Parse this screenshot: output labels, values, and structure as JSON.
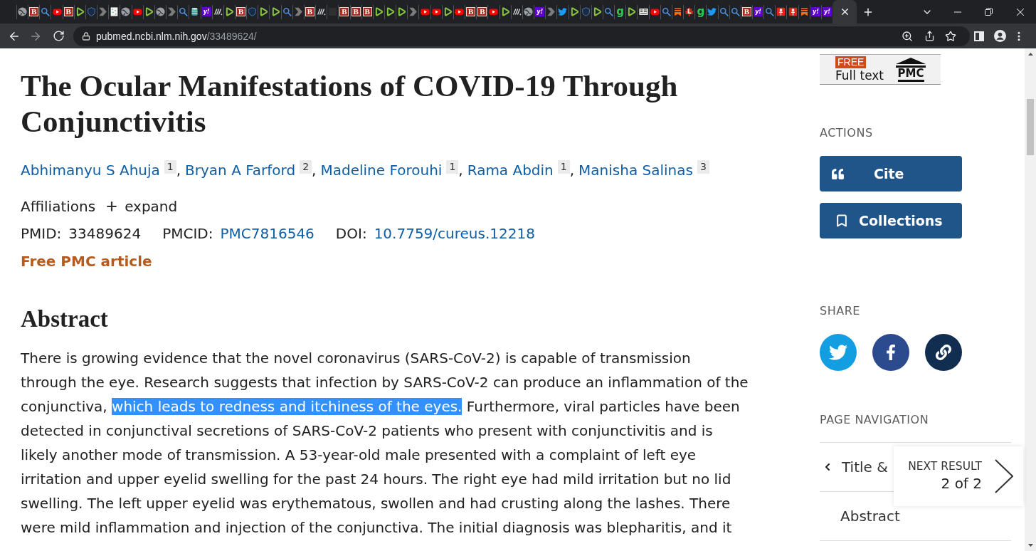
{
  "browser": {
    "tabs": [
      {
        "kind": "globe",
        "selected": false
      },
      {
        "kind": "serif-tile",
        "text": "B",
        "selected": false
      },
      {
        "kind": "search",
        "selected": false
      },
      {
        "kind": "video",
        "selected": false
      },
      {
        "kind": "serif-tile",
        "text": "B",
        "selected": false
      },
      {
        "kind": "play",
        "selected": false
      },
      {
        "kind": "shield",
        "selected": false
      },
      {
        "kind": "arrow",
        "selected": false
      },
      {
        "kind": "document",
        "selected": false
      },
      {
        "kind": "globe",
        "selected": false
      },
      {
        "kind": "video",
        "selected": false
      },
      {
        "kind": "play",
        "selected": false
      },
      {
        "kind": "globe",
        "selected": false
      },
      {
        "kind": "arrow",
        "selected": false
      },
      {
        "kind": "search",
        "selected": false
      },
      {
        "kind": "jar",
        "selected": false
      },
      {
        "kind": "yahoo-tile",
        "text": "y!",
        "selected": false
      },
      {
        "kind": "stripes",
        "selected": false
      },
      {
        "kind": "play",
        "selected": false
      },
      {
        "kind": "serif-tile",
        "text": "B",
        "selected": false
      },
      {
        "kind": "shield",
        "selected": false
      },
      {
        "kind": "play",
        "selected": false
      },
      {
        "kind": "play",
        "selected": false
      },
      {
        "kind": "search",
        "selected": false
      },
      {
        "kind": "arrow",
        "selected": false
      },
      {
        "kind": "serif-tile",
        "text": "B",
        "selected": false
      },
      {
        "kind": "stripes",
        "selected": false
      },
      {
        "kind": "blank",
        "selected": false
      },
      {
        "kind": "serif-tile",
        "text": "B",
        "selected": false
      },
      {
        "kind": "serif-tile",
        "text": "B",
        "selected": false
      },
      {
        "kind": "serif-tile",
        "text": "B",
        "selected": false
      },
      {
        "kind": "play",
        "selected": false
      },
      {
        "kind": "play",
        "selected": false
      },
      {
        "kind": "play",
        "selected": false
      },
      {
        "kind": "arrow",
        "selected": false
      },
      {
        "kind": "video",
        "selected": false
      },
      {
        "kind": "video",
        "selected": false
      },
      {
        "kind": "play",
        "selected": false
      },
      {
        "kind": "video",
        "selected": false
      },
      {
        "kind": "serif-tile",
        "text": "B",
        "selected": false
      },
      {
        "kind": "serif-tile",
        "text": "B",
        "selected": false
      },
      {
        "kind": "video",
        "selected": false
      },
      {
        "kind": "play",
        "selected": false
      },
      {
        "kind": "stripes",
        "selected": false
      },
      {
        "kind": "globe",
        "selected": false
      },
      {
        "kind": "yahoo-tile",
        "text": "y!",
        "selected": false
      },
      {
        "kind": "arrow",
        "selected": false
      },
      {
        "kind": "bird",
        "selected": false
      },
      {
        "kind": "play",
        "selected": false
      },
      {
        "kind": "shield",
        "selected": false
      },
      {
        "kind": "play",
        "selected": false
      },
      {
        "kind": "search",
        "selected": false
      },
      {
        "kind": "letter",
        "text": "g",
        "selected": false
      },
      {
        "kind": "play",
        "selected": false
      },
      {
        "kind": "news",
        "selected": false
      },
      {
        "kind": "video",
        "selected": false
      },
      {
        "kind": "search",
        "selected": false
      },
      {
        "kind": "bookmark",
        "selected": false
      },
      {
        "kind": "leaf",
        "text": "L",
        "selected": false
      },
      {
        "kind": "letter",
        "text": "g",
        "selected": false
      },
      {
        "kind": "bird",
        "selected": false
      },
      {
        "kind": "search",
        "selected": false
      },
      {
        "kind": "search",
        "selected": false
      },
      {
        "kind": "serif-tile",
        "text": "B",
        "selected": false
      },
      {
        "kind": "yahoo-tile",
        "text": "y!",
        "selected": false
      },
      {
        "kind": "search",
        "selected": false
      },
      {
        "kind": "pin",
        "selected": false
      },
      {
        "kind": "pin",
        "selected": false
      },
      {
        "kind": "bookmark",
        "selected": false
      },
      {
        "kind": "yahoo-tile",
        "text": "y!",
        "selected": false
      },
      {
        "kind": "yahoo-tile",
        "text": "y!",
        "selected": false
      },
      {
        "selected": true
      }
    ],
    "address": {
      "host": "pubmed.ncbi.nlm.nih.gov",
      "path": "/33489624/"
    }
  },
  "article": {
    "title": "The Ocular Manifestations of COVID-19 Through Conjunctivitis",
    "authors": [
      {
        "name": "Abhimanyu S Ahuja",
        "affiliation": "1",
        "separator": ","
      },
      {
        "name": "Bryan A Farford",
        "affiliation": "2",
        "separator": ","
      },
      {
        "name": "Madeline Forouhi",
        "affiliation": "1",
        "separator": ","
      },
      {
        "name": "Rama Abdin",
        "affiliation": "1",
        "separator": ","
      },
      {
        "name": "Manisha Salinas",
        "affiliation": "3"
      }
    ],
    "affiliations": {
      "label": "Affiliations",
      "toggle": "expand"
    },
    "identifiers": [
      {
        "label": "PMID:",
        "value": "33489624",
        "kind": "text"
      },
      {
        "label": "PMCID:",
        "value": "PMC7816546",
        "kind": "link"
      },
      {
        "label": "DOI:",
        "value": "10.7759/cureus.12218",
        "kind": "link"
      }
    ],
    "free_article": "Free PMC article",
    "abstract": {
      "heading": "Abstract",
      "segments": [
        {
          "text": "There is growing evidence that the novel coronavirus (SARS-CoV-2) is capable of transmission through the eye. Research suggests that infection by SARS-CoV-2 can produce an inflammation of the conjunctiva, ",
          "selected": false
        },
        {
          "text": "which leads to redness and itchiness of the eyes.",
          "selected": true
        },
        {
          "text": " Furthermore, viral particles have been detected in conjunctival secretions of SARS-CoV-2 patients who present with conjunctivitis and is likely another mode of transmission. A 53-year-old male presented with a complaint of left eye irritation and upper eyelid swelling for the past 24 hours. The right eye had mild irritation but no lid swelling. The left upper eyelid was erythematous, swollen and had crusting along the lashes. There were mild inflammation and injection of the conjunctiva. The initial diagnosis was blepharitis, and it",
          "selected": false
        }
      ]
    }
  },
  "sidebar": {
    "full_text_badge": {
      "tag": "FREE",
      "label": "Full text",
      "logo": "PMC"
    },
    "actions": {
      "heading": "ACTIONS",
      "buttons": [
        {
          "kind": "cite",
          "label": "Cite"
        },
        {
          "kind": "collections",
          "label": "Collections"
        }
      ]
    },
    "share": {
      "heading": "SHARE",
      "buttons": [
        {
          "kind": "twitter"
        },
        {
          "kind": "facebook"
        },
        {
          "kind": "link"
        }
      ]
    },
    "page_navigation": {
      "heading": "PAGE NAVIGATION",
      "items": [
        {
          "kind": "chevron",
          "label": "Title &"
        },
        {
          "kind": "plain",
          "label": "Abstract"
        }
      ]
    },
    "next_result": {
      "label": "NEXT RESULT",
      "count": "2 of 2"
    }
  }
}
